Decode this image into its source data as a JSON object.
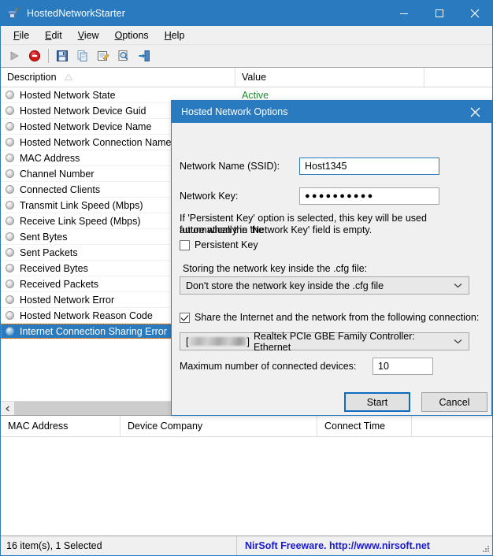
{
  "window": {
    "title": "HostedNetworkStarter",
    "icon": "network-adapter-icon",
    "minimize_label": "Minimize",
    "maximize_label": "Maximize",
    "close_label": "Close"
  },
  "menubar": {
    "items": [
      {
        "label": "File",
        "accel": "F"
      },
      {
        "label": "Edit",
        "accel": "E"
      },
      {
        "label": "View",
        "accel": "V"
      },
      {
        "label": "Options",
        "accel": "O"
      },
      {
        "label": "Help",
        "accel": "H"
      }
    ]
  },
  "toolbar": {
    "buttons": [
      {
        "name": "start-button",
        "icon": "play-icon",
        "enabled": false
      },
      {
        "name": "stop-button",
        "icon": "stop-icon",
        "enabled": true
      },
      {
        "name": "save-button",
        "icon": "floppy-disk-icon",
        "enabled": true
      },
      {
        "name": "copy-button",
        "icon": "copy-icon",
        "enabled": true
      },
      {
        "name": "properties-button",
        "icon": "properties-icon",
        "enabled": true
      },
      {
        "name": "find-button",
        "icon": "magnifier-icon",
        "enabled": true
      },
      {
        "name": "exit-button",
        "icon": "exit-door-icon",
        "enabled": true
      }
    ]
  },
  "upper_list": {
    "columns": [
      "Description",
      "Value"
    ],
    "sort_indicator": "ascending",
    "rows": [
      {
        "description": "Hosted Network State",
        "value": "Active",
        "value_color": "#1d8f2a",
        "selected": false
      },
      {
        "description": "Hosted Network Device Guid",
        "value": "",
        "selected": false
      },
      {
        "description": "Hosted Network Device Name",
        "value": "",
        "selected": false
      },
      {
        "description": "Hosted Network Connection Name",
        "value": "",
        "selected": false
      },
      {
        "description": "MAC Address",
        "value": "",
        "selected": false
      },
      {
        "description": "Channel Number",
        "value": "",
        "selected": false
      },
      {
        "description": "Connected Clients",
        "value": "",
        "selected": false
      },
      {
        "description": "Transmit Link Speed (Mbps)",
        "value": "",
        "selected": false
      },
      {
        "description": "Receive Link Speed (Mbps)",
        "value": "",
        "selected": false
      },
      {
        "description": "Sent Bytes",
        "value": "",
        "selected": false
      },
      {
        "description": "Sent Packets",
        "value": "",
        "selected": false
      },
      {
        "description": "Received Bytes",
        "value": "",
        "selected": false
      },
      {
        "description": "Received Packets",
        "value": "",
        "selected": false
      },
      {
        "description": "Hosted Network Error",
        "value": "",
        "selected": false
      },
      {
        "description": "Hosted Network Reason Code",
        "value": "",
        "selected": false
      },
      {
        "description": "Internet Connection Sharing Error",
        "value": "",
        "selected": true
      }
    ]
  },
  "lower_list": {
    "columns": [
      "MAC Address",
      "Device Company",
      "Connect Time"
    ],
    "rows": []
  },
  "statusbar": {
    "items_text": "16 item(s), 1 Selected",
    "credit_text": "NirSoft Freeware.  http://www.nirsoft.net",
    "credit_color": "#1a1ad0"
  },
  "dialog": {
    "title": "Hosted Network Options",
    "close_label": "Close",
    "ssid_label": "Network Name (SSID):",
    "ssid_value": "Host1345",
    "key_label": "Network Key:",
    "key_value": "●●●●●●●●●●",
    "help_line1": "If 'Persistent Key' option is selected, this key will be used automatically in the",
    "help_line2": "future when the 'Network Key' field is empty.",
    "persistent_key_label": "Persistent Key",
    "persistent_key_checked": false,
    "storing_label": "Storing the network key inside the .cfg file:",
    "storing_value": "Don't store the network key inside the .cfg file",
    "share_label": "Share the Internet and the network from the following connection:",
    "share_checked": true,
    "adapter_prefix": "[",
    "adapter_suffix": "]",
    "adapter_value": "Realtek PCIe GBE Family Controller: Ethernet",
    "max_devices_label": "Maximum number of connected devices:",
    "max_devices_value": "10",
    "start_label": "Start",
    "cancel_label": "Cancel"
  },
  "colors": {
    "accent": "#2a7ac0",
    "selection": "#2a7ac0",
    "active_green": "#1d8f2a",
    "link_blue": "#1a1ad0",
    "default_button_border": "#0f6cbd"
  }
}
